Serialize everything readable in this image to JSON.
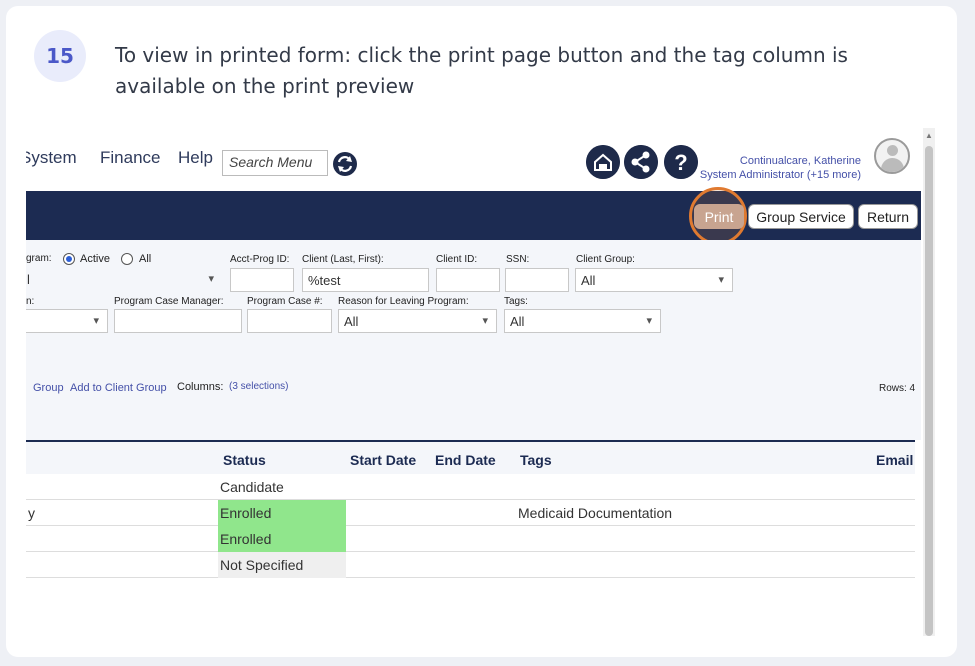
{
  "step": {
    "number": "15",
    "instruction": "To view in printed form: click the print page button and the tag column is available on the print preview"
  },
  "topbar": {
    "menu": [
      "System",
      "Finance",
      "Help"
    ],
    "search_placeholder": "Search Menu",
    "user_name": "Continualcare, Katherine",
    "user_role": "System Administrator (+15 more)"
  },
  "toolbar": {
    "print_label": "Print",
    "group_service_label": "Group Service",
    "return_label": "Return"
  },
  "filters": {
    "program_label": "gram:",
    "active_label": "Active",
    "all_label": "All",
    "program_value": "l",
    "acct_prog_label": "Acct-Prog ID:",
    "client_label": "Client (Last, First):",
    "client_value": "%test",
    "client_id_label": "Client ID:",
    "ssn_label": "SSN:",
    "client_group_label": "Client Group:",
    "client_group_value": "All",
    "row2_label": "n:",
    "case_manager_label": "Program Case Manager:",
    "case_num_label": "Program Case #:",
    "reason_label": "Reason for Leaving Program:",
    "reason_value": "All",
    "tags_label": "Tags:",
    "tags_value": "All"
  },
  "actions": {
    "group_link": "Group",
    "add_client_group_link": "Add to Client Group",
    "columns_label": "Columns:",
    "columns_link": "(3 selections)",
    "rows_label": "Rows: 4"
  },
  "table": {
    "headers": {
      "status": "Status",
      "start_date": "Start Date",
      "end_date": "End Date",
      "tags": "Tags",
      "email": "Email"
    },
    "rows": [
      {
        "lead": "",
        "status": "Candidate",
        "tags": ""
      },
      {
        "lead": "y",
        "status": "Enrolled",
        "tags": "Medicaid Documentation"
      },
      {
        "lead": "",
        "status": "Enrolled",
        "tags": ""
      },
      {
        "lead": "",
        "status": "Not Specified",
        "tags": ""
      }
    ]
  },
  "colors": {
    "navy": "#1c2b52",
    "enrolled_green": "#90e68c",
    "highlight_orange": "#e07a30"
  }
}
